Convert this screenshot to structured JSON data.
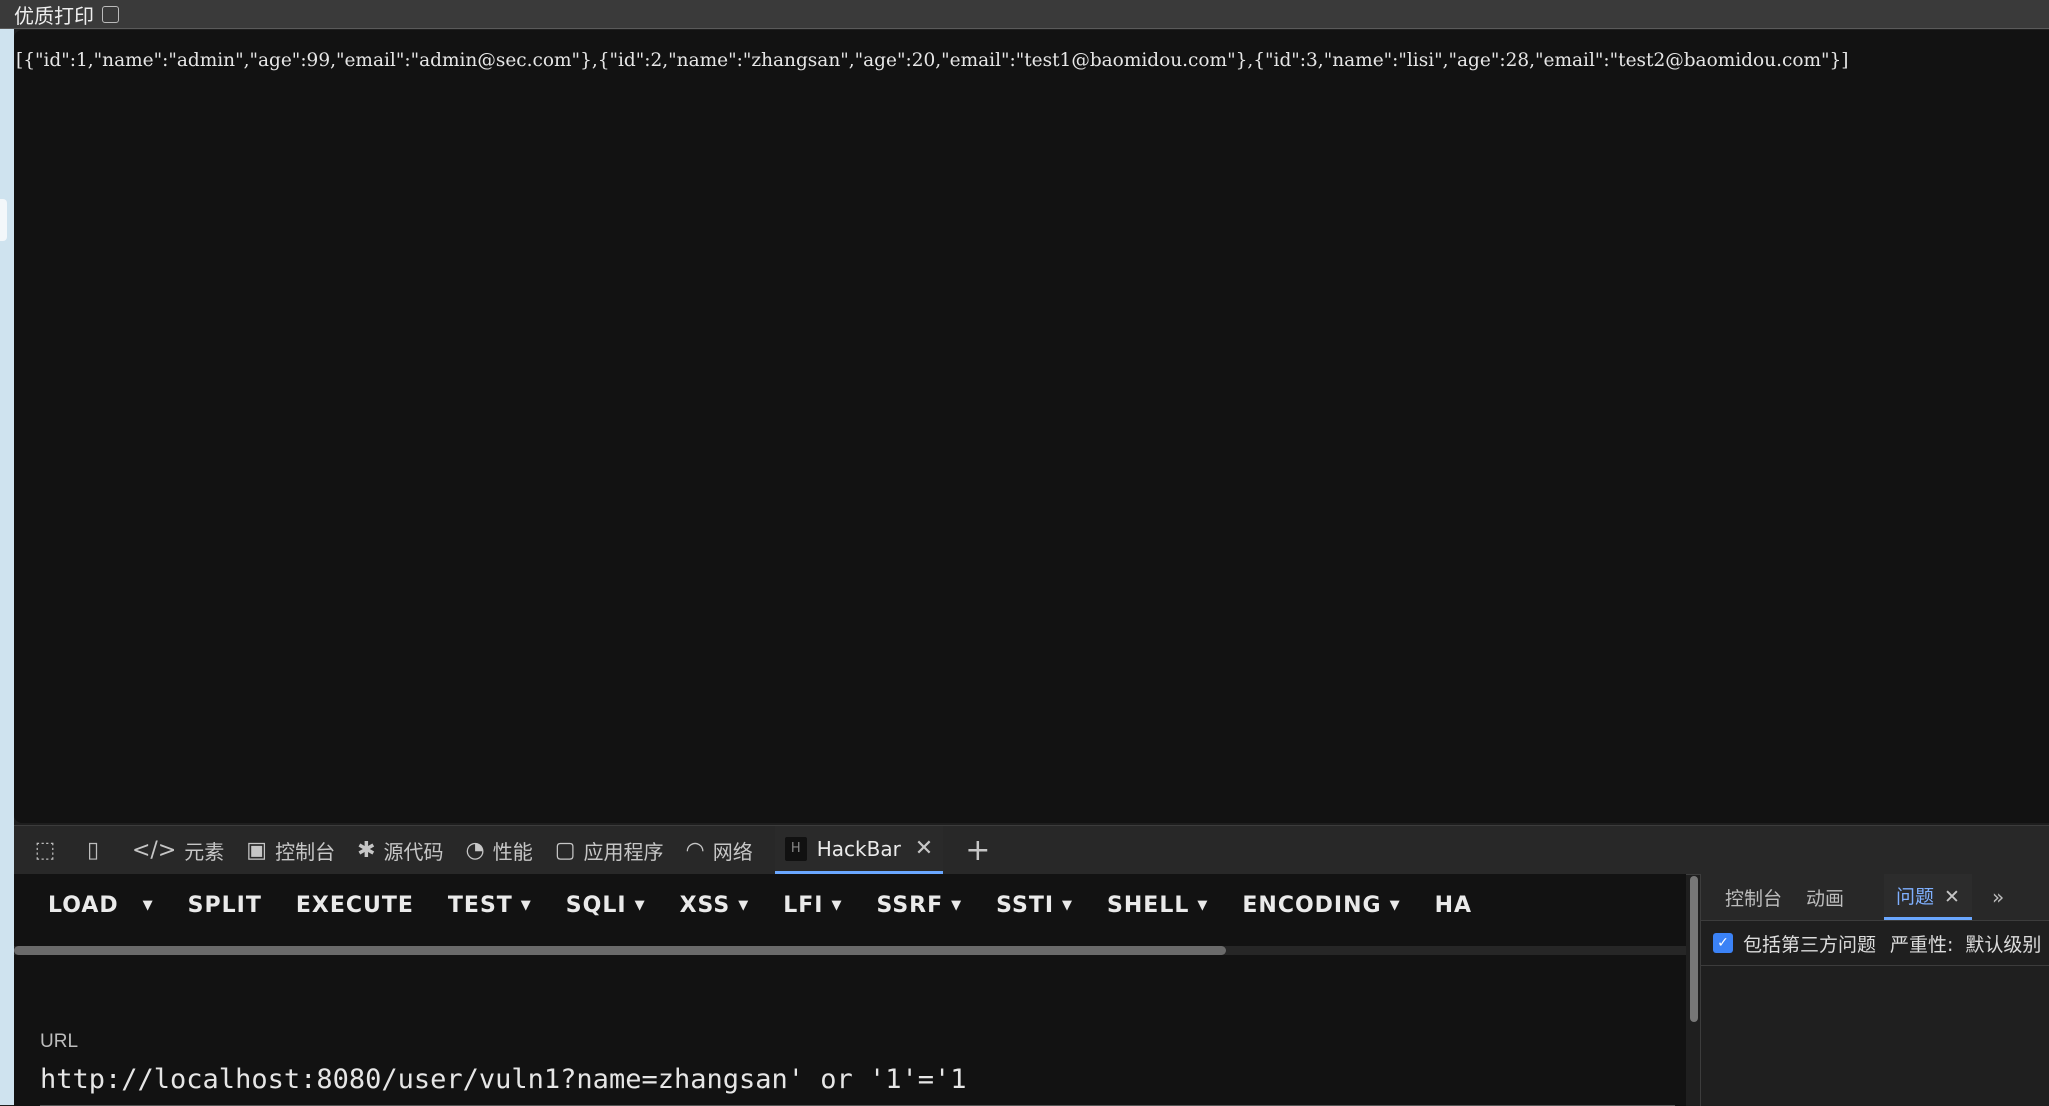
{
  "topbar": {
    "print_label": "优质打印"
  },
  "page": {
    "json_text": "[{\"id\":1,\"name\":\"admin\",\"age\":99,\"email\":\"admin@sec.com\"},{\"id\":2,\"name\":\"zhangsan\",\"age\":20,\"email\":\"test1@baomidou.com\"},{\"id\":3,\"name\":\"lisi\",\"age\":28,\"email\":\"test2@baomidou.com\"}]"
  },
  "devtools": {
    "tabs": [
      {
        "label": "元素",
        "icon": "code-icon"
      },
      {
        "label": "控制台",
        "icon": "console-icon"
      },
      {
        "label": "源代码",
        "icon": "bug-icon"
      },
      {
        "label": "性能",
        "icon": "gauge-icon"
      },
      {
        "label": "应用程序",
        "icon": "app-icon"
      },
      {
        "label": "网络",
        "icon": "wifi-icon"
      },
      {
        "label": "HackBar",
        "icon": "hackbar-icon"
      }
    ]
  },
  "hackbar": {
    "menu": [
      "LOAD",
      "SPLIT",
      "EXECUTE",
      "TEST",
      "SQLI",
      "XSS",
      "LFI",
      "SSRF",
      "SSTI",
      "SHELL",
      "ENCODING",
      "HA"
    ],
    "url_label": "URL",
    "url_value": "http://localhost:8080/user/vuln1?name=zhangsan' or '1'='1"
  },
  "drawer": {
    "tabs": [
      "控制台",
      "动画",
      "问题"
    ],
    "include_third_party": "包括第三方问题",
    "severity_label": "严重性:",
    "severity_value": "默认级别"
  },
  "colors": {
    "accent": "#6aa7ff",
    "checkbox": "#3b82f6",
    "page_bg": "#121212"
  }
}
